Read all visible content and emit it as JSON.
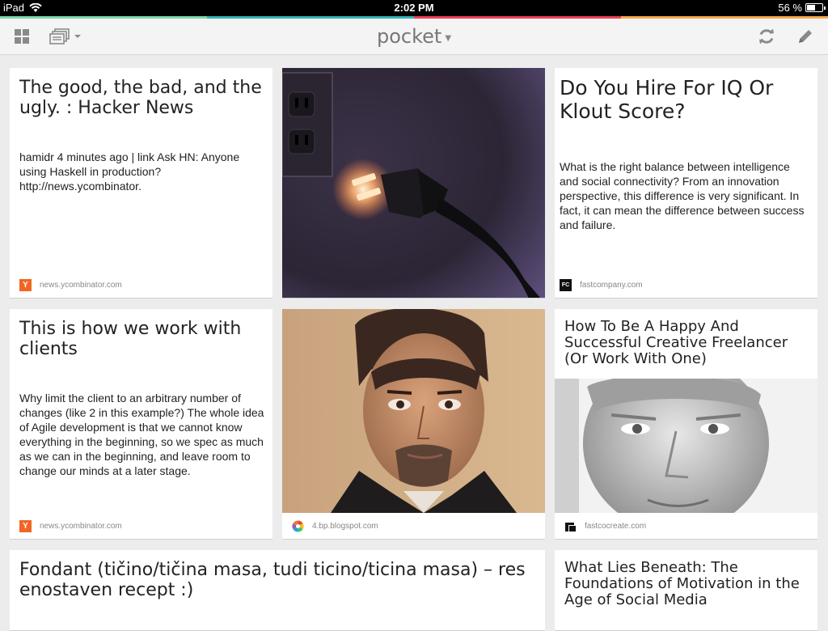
{
  "status": {
    "device": "iPad",
    "time": "2:02 PM",
    "battery": "56 %",
    "battery_level": 0.56
  },
  "accent_colors": [
    "#7fd6a9",
    "#36b3b8",
    "#ee4056",
    "#f6a94a"
  ],
  "toolbar": {
    "app_title": "pocket"
  },
  "cards": [
    {
      "title": "The good, the bad, and the ugly. : Hacker News",
      "excerpt": "hamidr 4 minutes ago | link Ask HN: Anyone using Haskell in production? http://news.ycombinator.",
      "source": "news.ycombinator.com",
      "favicon": "Y"
    },
    {
      "source": "",
      "image": "power-plug-photo"
    },
    {
      "title": "Do You Hire For IQ Or Klout Score?",
      "excerpt": "What is the right balance between intelligence and social connectivity? From an innovation perspective, this difference is very significant. In fact, it can mean the difference between success and failure.",
      "source": "fastcompany.com",
      "favicon": "FC"
    },
    {
      "title": "This is how we work with clients",
      "excerpt": "Why limit the client to an arbitrary number of changes (like 2 in this example?) The whole idea of Agile development is that we cannot know everything in the beginning, so we spec as much as we can in the beginning, and leave room to change our minds at a later stage.",
      "source": "news.ycombinator.com",
      "favicon": "Y"
    },
    {
      "source": "4.bp.blogspot.com",
      "image": "portrait-photo"
    },
    {
      "title": "How To Be A Happy And Successful Creative Freelancer (Or Work With One)",
      "source": "fastcocreate.com",
      "image": "bw-portrait-photo"
    },
    {
      "title": "Fondant (tičino/tičina masa, tudi ticino/ticina masa) – res enostaven recept :)"
    },
    {
      "title": "What Lies Beneath: The Foundations of Motivation in the Age of Social Media"
    }
  ]
}
